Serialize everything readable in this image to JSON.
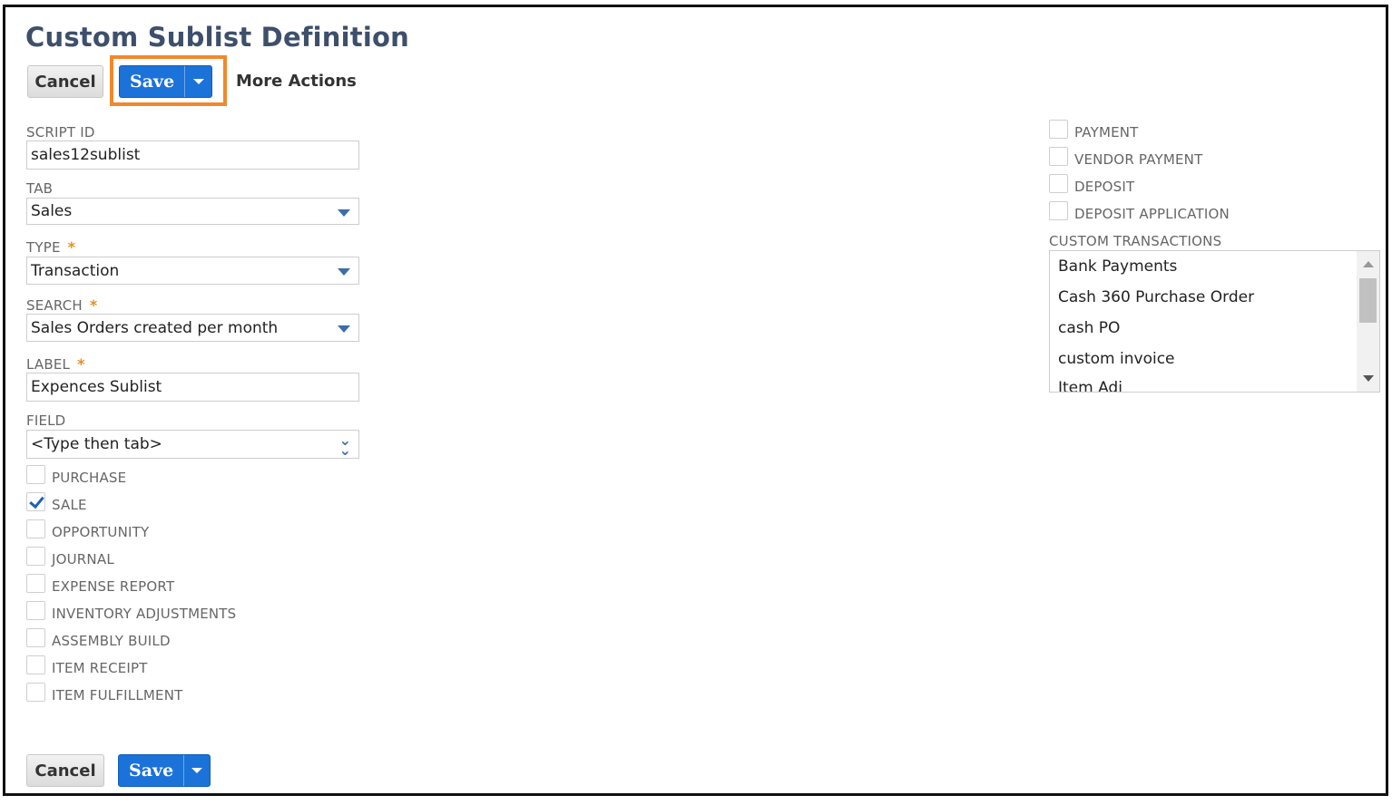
{
  "page": {
    "title": "Custom Sublist Definition"
  },
  "toolbar": {
    "cancel_label": "Cancel",
    "save_label": "Save",
    "more_actions_label": "More Actions"
  },
  "form": {
    "script_id": {
      "label": "SCRIPT ID",
      "value": "sales12sublist"
    },
    "tab": {
      "label": "TAB",
      "value": "Sales"
    },
    "type": {
      "label": "TYPE",
      "value": "Transaction",
      "required_mark": "*"
    },
    "search": {
      "label": "SEARCH",
      "value": "Sales Orders created per month",
      "required_mark": "*"
    },
    "label_field": {
      "label": "LABEL",
      "value": "Expences Sublist",
      "required_mark": "*"
    },
    "field": {
      "label": "FIELD",
      "value": "<Type then tab>"
    }
  },
  "checkboxes_left": [
    {
      "label": "PURCHASE",
      "checked": false
    },
    {
      "label": "SALE",
      "checked": true
    },
    {
      "label": "OPPORTUNITY",
      "checked": false
    },
    {
      "label": "JOURNAL",
      "checked": false
    },
    {
      "label": "EXPENSE REPORT",
      "checked": false
    },
    {
      "label": "INVENTORY ADJUSTMENTS",
      "checked": false
    },
    {
      "label": "ASSEMBLY BUILD",
      "checked": false
    },
    {
      "label": "ITEM RECEIPT",
      "checked": false
    },
    {
      "label": "ITEM FULFILLMENT",
      "checked": false
    }
  ],
  "checkboxes_right": [
    {
      "label": "PAYMENT",
      "checked": false
    },
    {
      "label": "VENDOR PAYMENT",
      "checked": false
    },
    {
      "label": "DEPOSIT",
      "checked": false
    },
    {
      "label": "DEPOSIT APPLICATION",
      "checked": false
    }
  ],
  "custom_transactions": {
    "label": "CUSTOM TRANSACTIONS",
    "items": [
      "Bank Payments",
      "Cash 360 Purchase Order",
      "cash PO",
      "custom invoice",
      "Item Adj"
    ]
  },
  "colors": {
    "title": "#3d4f6b",
    "primary_button": "#1b72d8",
    "highlight": "#f2882b",
    "required": "#e39022"
  }
}
